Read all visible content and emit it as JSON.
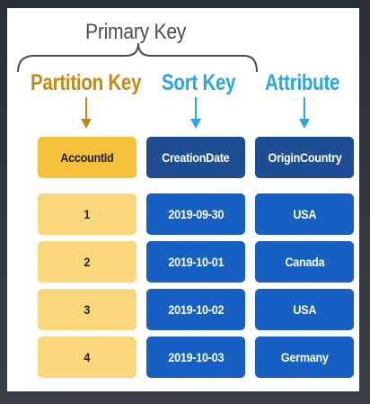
{
  "title": "Primary Key",
  "columns": [
    {
      "heading": "Partition Key",
      "field": "AccountId",
      "color": "#c08a16"
    },
    {
      "heading": "Sort Key",
      "field": "CreationDate",
      "color": "#2aa6e4"
    },
    {
      "heading": "Attribute",
      "field": "OriginCountry",
      "color": "#2aa6e4"
    }
  ],
  "rows": [
    {
      "account_id": "1",
      "creation_date": "2019-09-30",
      "origin_country": "USA"
    },
    {
      "account_id": "2",
      "creation_date": "2019-10-01",
      "origin_country": "Canada"
    },
    {
      "account_id": "3",
      "creation_date": "2019-10-02",
      "origin_country": "USA"
    },
    {
      "account_id": "4",
      "creation_date": "2019-10-03",
      "origin_country": "Germany"
    }
  ]
}
